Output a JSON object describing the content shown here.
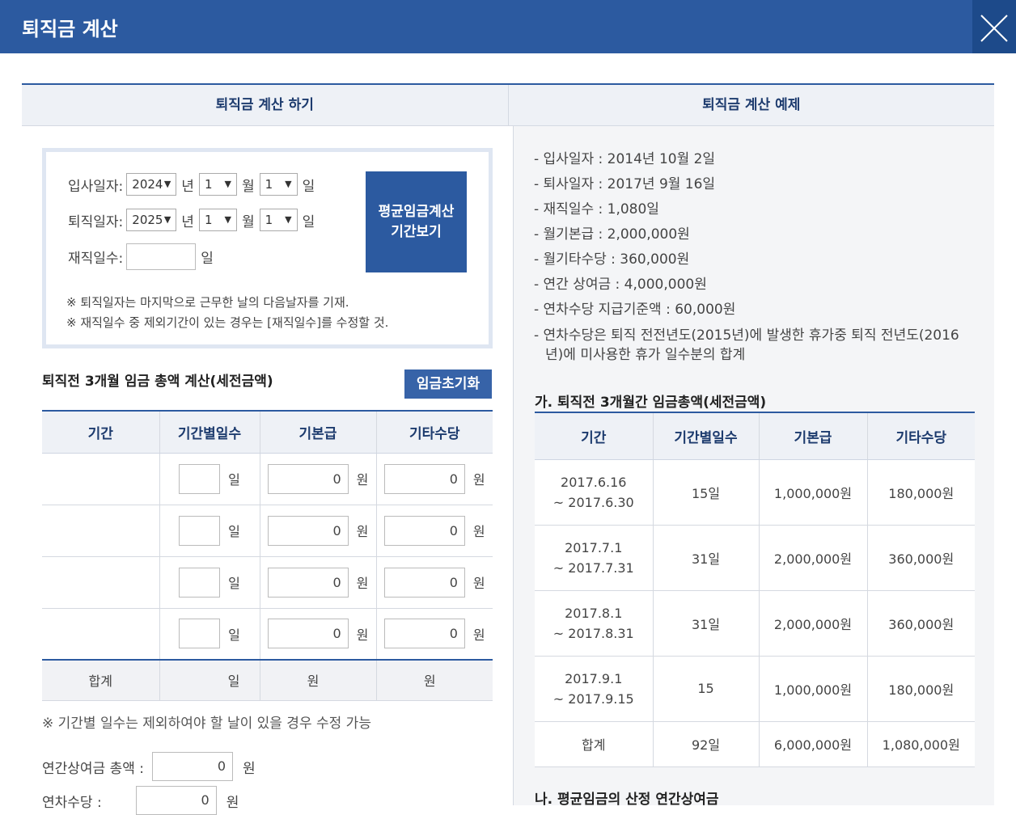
{
  "header": {
    "title": "퇴직금 계산"
  },
  "tabs": {
    "left": "퇴직금 계산 하기",
    "right": "퇴직금 계산 예제"
  },
  "form": {
    "hire_label": "입사일자:",
    "hire_year": "2024",
    "hire_month": "1",
    "hire_day": "1",
    "leave_label": "퇴직일자:",
    "leave_year": "2025",
    "leave_month": "1",
    "leave_day": "1",
    "unit_year": "년",
    "unit_month": "월",
    "unit_day": "일",
    "tenure_label": "재직일수:",
    "tenure_unit": "일",
    "calc_button_line1": "평균임금계산",
    "calc_button_line2": "기간보기",
    "note1": "※ 퇴직일자는 마지막으로 근무한 날의 다음날자를 기재.",
    "note2": "※ 재직일수 중 제외기간이 있는 경우는 [재직일수]를 수정할 것."
  },
  "wage_section": {
    "title": "퇴직전 3개월 임금 총액 계산(세전금액)",
    "reset_button": "임금초기화",
    "headers": [
      "기간",
      "기간별일수",
      "기본급",
      "기타수당"
    ],
    "rows": [
      {
        "days_unit": "일",
        "base": "0",
        "base_unit": "원",
        "other": "0",
        "other_unit": "원"
      },
      {
        "days_unit": "일",
        "base": "0",
        "base_unit": "원",
        "other": "0",
        "other_unit": "원"
      },
      {
        "days_unit": "일",
        "base": "0",
        "base_unit": "원",
        "other": "0",
        "other_unit": "원"
      },
      {
        "days_unit": "일",
        "base": "0",
        "base_unit": "원",
        "other": "0",
        "other_unit": "원"
      }
    ],
    "sum": {
      "label": "합계",
      "days": "일",
      "base": "원",
      "other": "원"
    },
    "note": "※ 기간별 일수는 제외하여야 할 날이 있을 경우 수정 가능",
    "bonus_label": "연간상여금 총액 :",
    "bonus_value": "0",
    "bonus_unit": "원",
    "leave_pay_label": "연차수당 :",
    "leave_pay_value": "0",
    "leave_pay_unit": "원"
  },
  "example": {
    "items": [
      "- 입사일자 : 2014년 10월 2일",
      "- 퇴사일자 : 2017년 9월 16일",
      "- 재직일수 : 1,080일",
      "- 월기본급 : 2,000,000원",
      "- 월기타수당 : 360,000원",
      "- 연간 상여금 : 4,000,000원",
      "- 연차수당 지급기준액 : 60,000원",
      "- 연차수당은 퇴직 전전년도(2015년)에 발생한 휴가중 퇴직 전년도(2016년)에 미사용한 휴가 일수분의 합계"
    ],
    "section_a": "가. 퇴직전 3개월간 임금총액(세전금액)",
    "headers": [
      "기간",
      "기간별일수",
      "기본급",
      "기타수당"
    ],
    "rows": [
      {
        "from": "2017.6.16",
        "to": "~ 2017.6.30",
        "days": "15일",
        "base": "1,000,000원",
        "other": "180,000원"
      },
      {
        "from": "2017.7.1",
        "to": "~ 2017.7.31",
        "days": "31일",
        "base": "2,000,000원",
        "other": "360,000원"
      },
      {
        "from": "2017.8.1",
        "to": "~ 2017.8.31",
        "days": "31일",
        "base": "2,000,000원",
        "other": "360,000원"
      },
      {
        "from": "2017.9.1",
        "to": "~ 2017.9.15",
        "days": "15",
        "base": "1,000,000원",
        "other": "180,000원"
      }
    ],
    "sum": {
      "label": "합계",
      "days": "92일",
      "base": "6,000,000원",
      "other": "1,080,000원"
    },
    "section_b": "나. 평균임금의 산정 연간상여금"
  }
}
